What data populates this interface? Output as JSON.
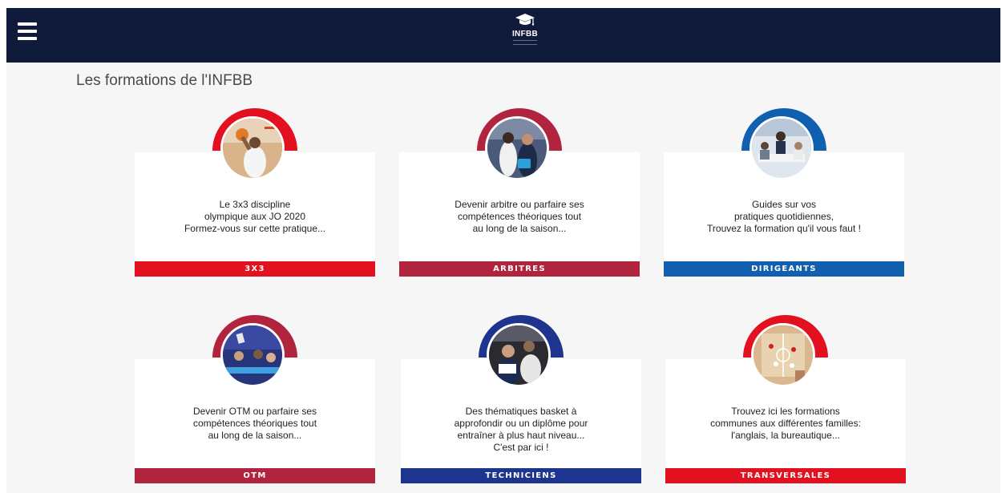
{
  "header": {
    "logo_text": "INFBB"
  },
  "page": {
    "title": "Les formations de l'INFBB"
  },
  "cards": [
    {
      "text": "Le 3x3 discipline\nolympique aux JO 2020\nFormez-vous sur cette pratique...",
      "banner": "3X3",
      "color": "#e3101f",
      "icon": "basketball-3x3-photo"
    },
    {
      "text": "Devenir arbitre ou parfaire ses\ncompétences théoriques tout\nau long de la saison...",
      "banner": "ARBITRES",
      "color": "#b0243e",
      "icon": "referee-photo"
    },
    {
      "text": "Guides sur vos\npratiques quotidiennes,\nTrouvez la formation qu'il vous faut !",
      "banner": "DIRIGEANTS",
      "color": "#1160b0",
      "icon": "meeting-photo"
    },
    {
      "text": "Devenir OTM ou parfaire ses\ncompétences théoriques tout\nau long de la saison...",
      "banner": "OTM",
      "color": "#b0243e",
      "icon": "scorers-table-photo"
    },
    {
      "text": "Des thématiques basket à\napprofondir ou un diplôme pour\nentraîner à plus haut  niveau...\nC'est par ici !",
      "banner": "TECHNICIENS",
      "color": "#1e3590",
      "icon": "coaches-photo"
    },
    {
      "text": "Trouvez ici les formations\ncommunes aux différentes familles:\nl'anglais, la bureautique...",
      "banner": "TRANSVERSALES",
      "color": "#e3101f",
      "icon": "tactics-board-photo"
    }
  ]
}
